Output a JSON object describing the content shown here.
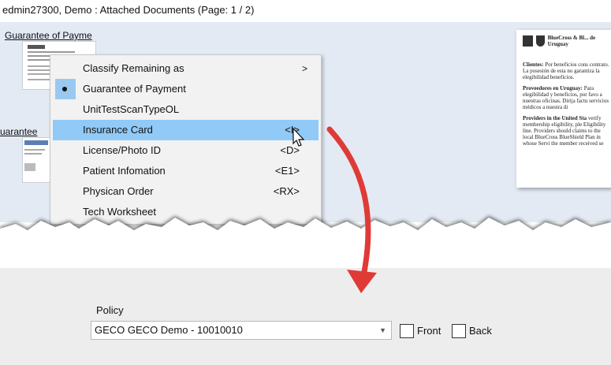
{
  "window": {
    "title": "edmin27300, Demo : Attached Documents (Page: 1 / 2)"
  },
  "thumbnails": [
    {
      "title": "Guarantee of Payme"
    },
    {
      "title": "uarantee"
    }
  ],
  "preview": {
    "brand": "BlueCross & Bl... de Uruguay",
    "para1_head": "Clientes:",
    "para1": "Por beneficios cons contrato. La posesión de esta no garantiza la elegibilidad beneficios.",
    "para2_head": "Proveedores en Uruguay:",
    "para2": "Para elegibilidad y beneficios, por favo a nuestras oficinas. Dirija factu servicios médicos a nuestra di",
    "para3_head": "Providers in the United Sta",
    "para3": "verify membership eligibility, ple Eligibility line. Providers should claims to the local BlueCross BlueShield Plan in whose Servi the member received se"
  },
  "context_menu": {
    "items": [
      {
        "label": "Classify Remaining as",
        "key": "",
        "submenu": true,
        "checked": false,
        "highlighted": false
      },
      {
        "label": "Guarantee of Payment",
        "key": "",
        "submenu": false,
        "checked": true,
        "highlighted": false
      },
      {
        "label": "UnitTestScanTypeOL",
        "key": "",
        "submenu": false,
        "checked": false,
        "highlighted": false
      },
      {
        "label": "Insurance Card",
        "key": "<I>",
        "submenu": false,
        "checked": false,
        "highlighted": true
      },
      {
        "label": "License/Photo ID",
        "key": "<D>",
        "submenu": false,
        "checked": false,
        "highlighted": false
      },
      {
        "label": "Patient Infomation",
        "key": "<E1>",
        "submenu": false,
        "checked": false,
        "highlighted": false
      },
      {
        "label": "Physican Order",
        "key": "<RX>",
        "submenu": false,
        "checked": false,
        "highlighted": false
      },
      {
        "label": "Tech Worksheet",
        "key": "",
        "submenu": false,
        "checked": false,
        "highlighted": false
      }
    ],
    "submenu_glyph": ">"
  },
  "policy": {
    "label": "Policy",
    "selected": "GECO GECO Demo - 10010010",
    "front_label": "Front",
    "back_label": "Back"
  },
  "colors": {
    "highlight": "#91c9f7",
    "arrow": "#e03a36",
    "workspace": "#e3eaf4"
  }
}
